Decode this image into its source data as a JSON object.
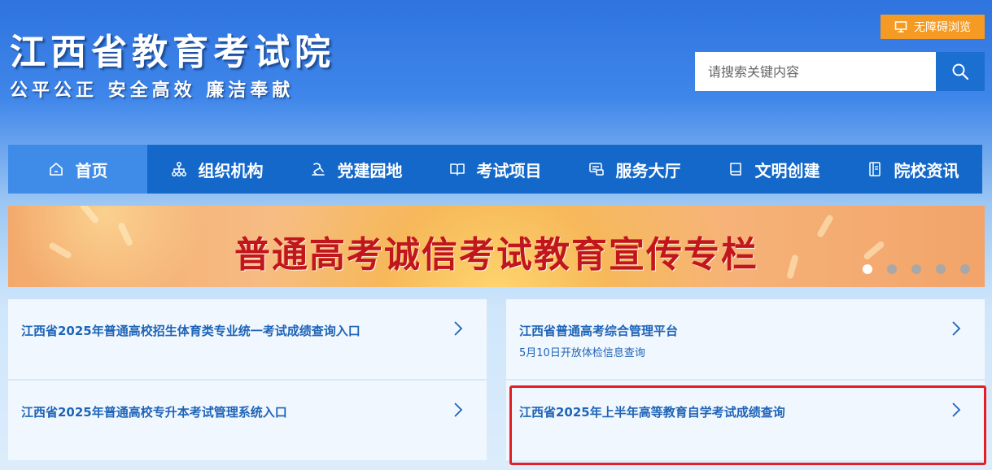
{
  "header": {
    "site_title": "江西省教育考试院",
    "slogan": "公平公正  安全高效  廉洁奉献",
    "accessibility_label": "无障碍浏览",
    "search_placeholder": "请搜索关键内容"
  },
  "nav": {
    "items": [
      {
        "label": "首页",
        "icon": "home-icon",
        "active": true
      },
      {
        "label": "组织机构",
        "icon": "org-chart-icon",
        "active": false
      },
      {
        "label": "党建园地",
        "icon": "party-building-icon",
        "active": false
      },
      {
        "label": "考试项目",
        "icon": "open-book-icon",
        "active": false
      },
      {
        "label": "服务大厅",
        "icon": "service-icon",
        "active": false
      },
      {
        "label": "文明创建",
        "icon": "book-icon",
        "active": false
      },
      {
        "label": "院校资讯",
        "icon": "document-icon",
        "active": false
      }
    ]
  },
  "banner": {
    "title": "普通高考诚信考试教育宣传专栏",
    "slide_count": 5,
    "active_slide": 1
  },
  "cards": [
    {
      "title": "江西省2025年普通高校招生体育类专业统一考试成绩查询入口",
      "subtitle": ""
    },
    {
      "title": "江西省普通高考综合管理平台",
      "subtitle": "5月10日开放体检信息查询"
    },
    {
      "title": "江西省2025年普通高校专升本考试管理系统入口",
      "subtitle": ""
    },
    {
      "title": "江西省2025年上半年高等教育自学考试成绩查询",
      "subtitle": ""
    }
  ],
  "colors": {
    "nav_bg": "#1468c9",
    "nav_active": "#3f8ce8",
    "accessibility_btn": "#f59a23",
    "card_text": "#1e64b8",
    "banner_title": "#c1161c",
    "highlight": "#e31e24"
  }
}
